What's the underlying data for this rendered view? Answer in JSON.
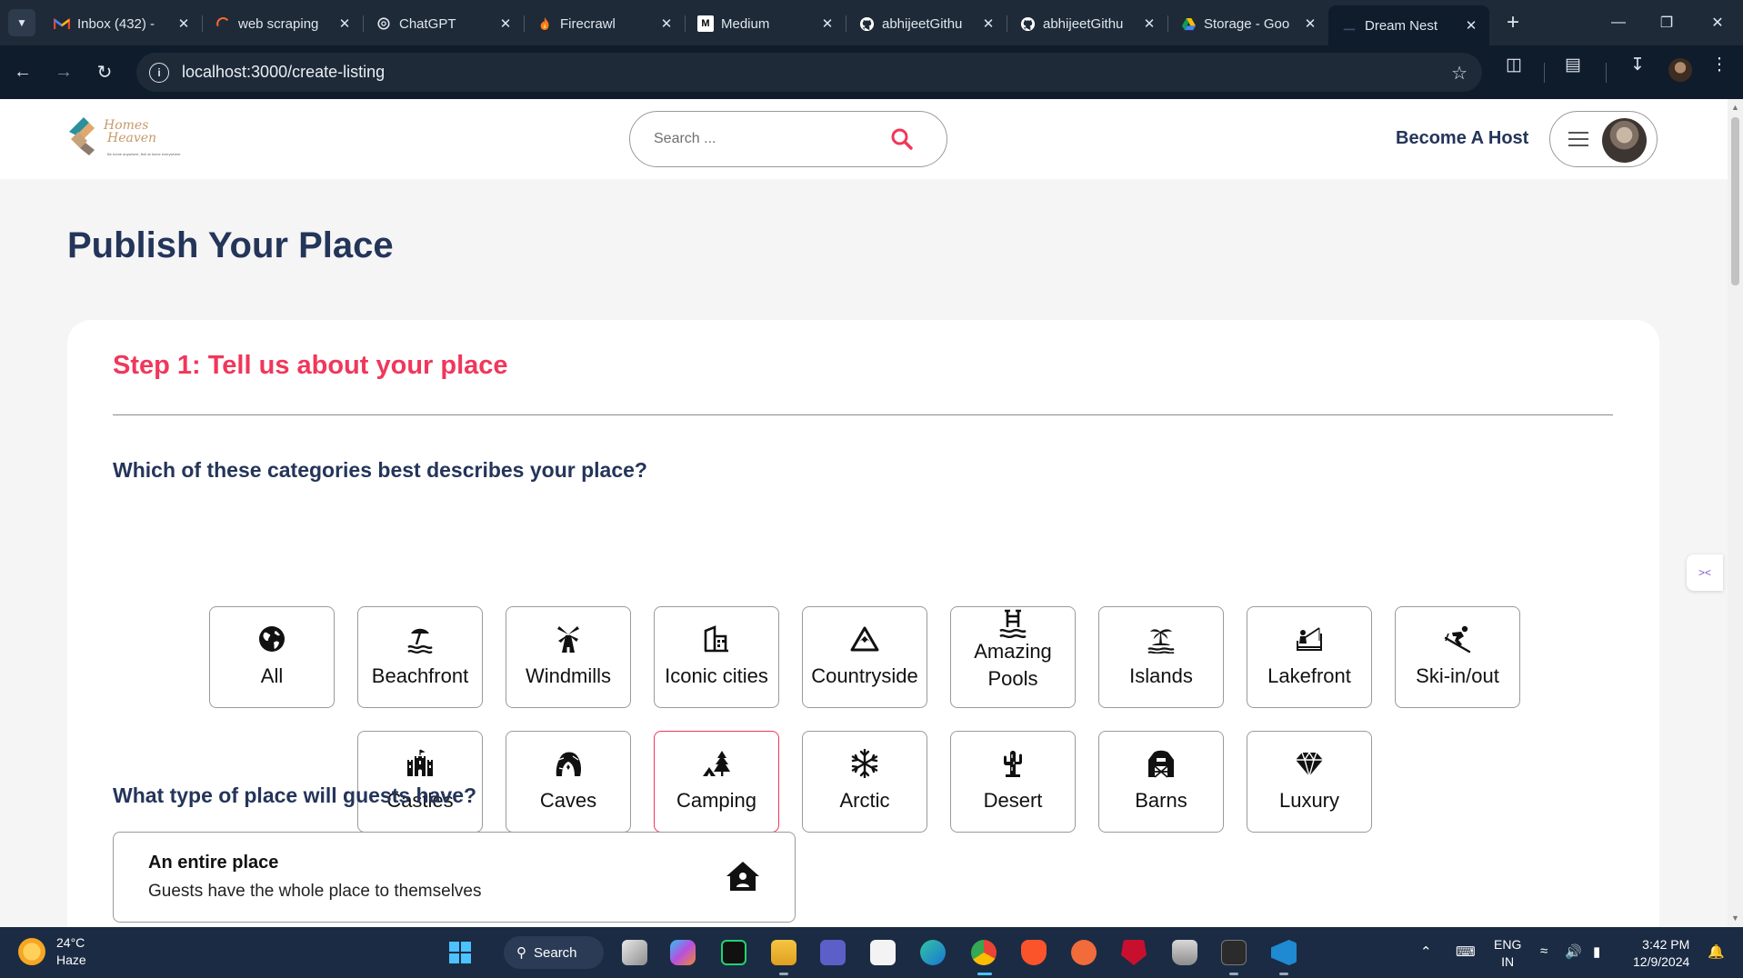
{
  "browser": {
    "tabs": [
      {
        "title": "Inbox (432) -",
        "icon": "gmail-icon",
        "active": false
      },
      {
        "title": "web scraping",
        "icon": "loader-icon",
        "active": false
      },
      {
        "title": "ChatGPT",
        "icon": "chatgpt-icon",
        "active": false
      },
      {
        "title": "Firecrawl",
        "icon": "fire-icon",
        "active": false
      },
      {
        "title": "Medium",
        "icon": "medium-icon",
        "active": false
      },
      {
        "title": "abhijeetGithu",
        "icon": "github-icon",
        "active": false
      },
      {
        "title": "abhijeetGithu",
        "icon": "github-icon",
        "active": false
      },
      {
        "title": "Storage - Goo",
        "icon": "drive-icon",
        "active": false
      },
      {
        "title": "Dream Nest",
        "icon": "site-icon",
        "active": true
      }
    ],
    "new_tab": "+",
    "url": "localhost:3000/create-listing"
  },
  "navbar": {
    "logo_text_line1": "Homes",
    "logo_text_line2": "Heaven",
    "logo_tagline": "Be home anywhere, feel at home everywhere",
    "search_placeholder": "Search ...",
    "become_host": "Become A Host"
  },
  "page": {
    "title": "Publish Your Place",
    "step_title": "Step 1: Tell us about your place",
    "categories_question": "Which of these categories best describes your place?",
    "categories": [
      {
        "label": "All",
        "icon": "globe-icon"
      },
      {
        "label": "Beachfront",
        "icon": "beach-icon"
      },
      {
        "label": "Windmills",
        "icon": "windmill-icon"
      },
      {
        "label": "Iconic cities",
        "icon": "city-icon"
      },
      {
        "label": "Countryside",
        "icon": "mountain-icon"
      },
      {
        "label": "Amazing Pools",
        "icon": "pool-icon"
      },
      {
        "label": "Islands",
        "icon": "island-icon"
      },
      {
        "label": "Lakefront",
        "icon": "lake-icon"
      },
      {
        "label": "Ski-in/out",
        "icon": "skier-icon"
      },
      {
        "label": "Castles",
        "icon": "castle-icon"
      },
      {
        "label": "Caves",
        "icon": "cave-icon"
      },
      {
        "label": "Camping",
        "icon": "camping-icon",
        "selected": true
      },
      {
        "label": "Arctic",
        "icon": "snowflake-icon"
      },
      {
        "label": "Desert",
        "icon": "cactus-icon"
      },
      {
        "label": "Barns",
        "icon": "barn-icon"
      },
      {
        "label": "Luxury",
        "icon": "diamond-icon"
      }
    ],
    "type_question": "What type of place will guests have?",
    "type_option": {
      "title": "An entire place",
      "description": "Guests have the whole place to themselves",
      "icon": "house-user-icon"
    }
  },
  "taskbar": {
    "temperature": "24°C",
    "condition": "Haze",
    "search_label": "Search",
    "lang_line1": "ENG",
    "lang_line2": "IN",
    "time": "3:42 PM",
    "date": "12/9/2024"
  },
  "colors": {
    "accent": "#f0375b",
    "heading": "#24355a",
    "tabbar": "#1f2a38",
    "taskbar": "#1b2b44"
  }
}
